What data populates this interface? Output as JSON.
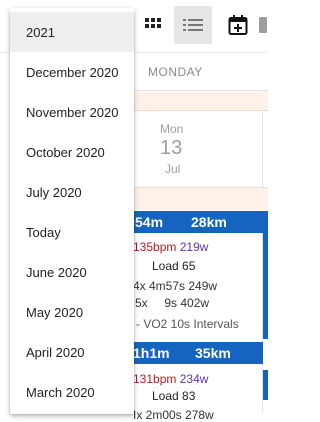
{
  "toolbar": {
    "buttons": [
      {
        "icon": "grid-view-icon"
      },
      {
        "icon": "list-view-icon",
        "active": true
      },
      {
        "icon": "calendar-add-icon"
      }
    ]
  },
  "calendar": {
    "weekday_header": "MONDAY",
    "date": {
      "day": "Mon",
      "number": "13",
      "month": "Jul"
    }
  },
  "workouts": [
    {
      "header_left": "54m",
      "header_right": "28km",
      "hr": "135bpm",
      "power": "219w",
      "load": "Load 65",
      "line1": "4x 4m57s 249w",
      "line2": "5x     9s 402w",
      "title": "- VO2 10s Intervals"
    },
    {
      "header_left": "1h1m",
      "header_right": "35km",
      "hr": "131bpm",
      "power": "234w",
      "load": "Load 83",
      "line1": "Ix 2m00s 278w"
    }
  ],
  "dropdown": {
    "items": [
      {
        "label": "2021",
        "selected": true
      },
      {
        "label": "December 2020"
      },
      {
        "label": "November 2020"
      },
      {
        "label": "October 2020"
      },
      {
        "label": "July 2020"
      },
      {
        "label": "Today"
      },
      {
        "label": "June 2020"
      },
      {
        "label": "May 2020"
      },
      {
        "label": "April 2020"
      },
      {
        "label": "March 2020"
      }
    ]
  },
  "colors": {
    "accent_blue": "#1565c0",
    "heart_rate": "#b71c1c",
    "power": "#5e35b1",
    "highlight_peach": "#fdf1ea"
  }
}
